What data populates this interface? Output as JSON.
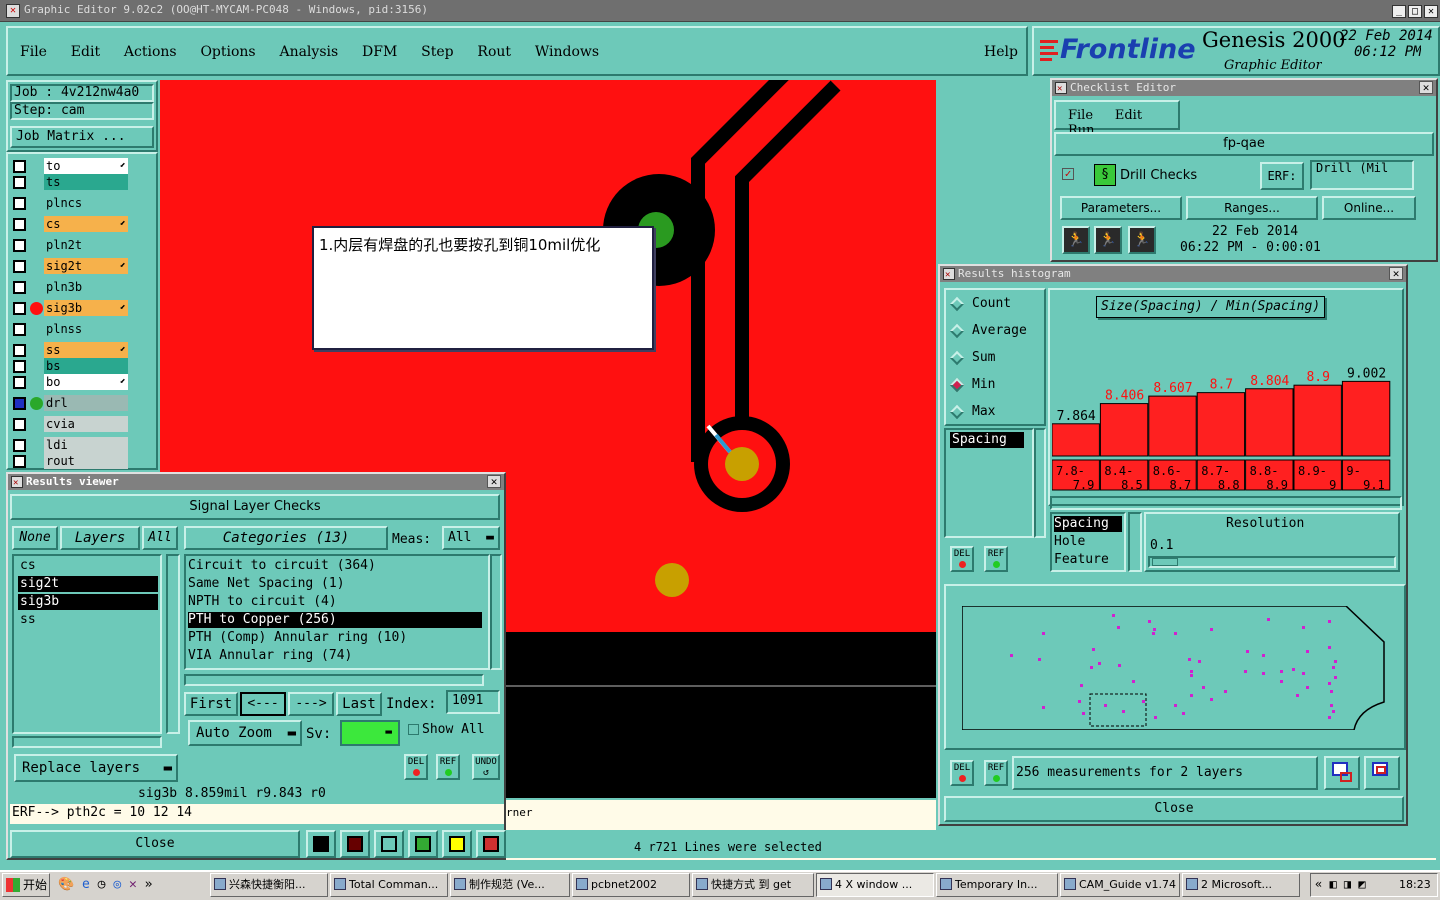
{
  "window": {
    "title": "Graphic Editor 9.02c2  (OO@HT-MYCAM-PC048 - Windows, pid:3156)"
  },
  "menu": [
    "File",
    "Edit",
    "Actions",
    "Options",
    "Analysis",
    "DFM",
    "Step",
    "Rout",
    "Windows"
  ],
  "help": "Help",
  "brand": {
    "logo": "Frontline",
    "product": "Genesis 2000",
    "subtitle": "Graphic Editor",
    "date": "22 Feb 2014",
    "time": "06:12 PM"
  },
  "job": {
    "job": "Job : 4v212nw4a0",
    "step": "Step: cam",
    "matrix": "Job Matrix ..."
  },
  "layers": [
    {
      "name": "to",
      "color": "#ffffff"
    },
    {
      "name": "ts",
      "color": "#2aa88f"
    },
    {
      "name": "plncs",
      "color": "#6dc9b9"
    },
    {
      "name": "cs",
      "color": "#f6b14b"
    },
    {
      "name": "pln2t",
      "color": "#6dc9b9"
    },
    {
      "name": "sig2t",
      "color": "#f6b14b"
    },
    {
      "name": "pln3b",
      "color": "#6dc9b9"
    },
    {
      "name": "sig3b",
      "color": "#f6b14b"
    },
    {
      "name": "plnss",
      "color": "#6dc9b9"
    },
    {
      "name": "ss",
      "color": "#f6b14b"
    },
    {
      "name": "bs",
      "color": "#2aa88f"
    },
    {
      "name": "bo",
      "color": "#ffffff"
    },
    {
      "name": "drl",
      "color": "#9ab9b3"
    },
    {
      "name": "cvia",
      "color": "#c8d3d0"
    },
    {
      "name": "ldi",
      "color": "#c8d3d0"
    },
    {
      "name": "rout",
      "color": "#c8d3d0"
    }
  ],
  "note": "1.内层有焊盘的孔也要按孔到铜10mil优化",
  "results_viewer": {
    "title": "Results viewer",
    "header": "Signal Layer Checks",
    "none": "None",
    "layers": "Layers",
    "all": "All",
    "categories": "Categories (13)",
    "meas_label": "Meas:",
    "meas_value": "All",
    "layer_list": [
      "cs",
      "sig2t",
      "sig3b",
      "ss"
    ],
    "category_list": [
      "Circuit to circuit (364)",
      "Same Net Spacing (1)",
      "NPTH to circuit (4)",
      "PTH to Copper (256)",
      "PTH (Comp) Annular ring (10)",
      "VIA Annular ring (74)"
    ],
    "first": "First",
    "prev": "<---",
    "next": "--->",
    "last": "Last",
    "index_label": "Index:",
    "index_value": "1091",
    "auto_zoom": "Auto Zoom",
    "sv": "Sv:",
    "show_all": "Show All",
    "replace": "Replace layers",
    "del": "DEL",
    "ref": "REF",
    "undo": "UNDO",
    "status": "sig3b 8.859mil  r9.843  r0",
    "erf": "ERF--> pth2c = 10 12 14",
    "close": "Close"
  },
  "checklist": {
    "title": "Checklist Editor",
    "menu": [
      "File",
      "Edit",
      "Run"
    ],
    "name": "fp-qae",
    "check": "Drill Checks",
    "erf": "ERF:",
    "erf_value": "Drill (Mil",
    "parameters": "Parameters...",
    "ranges": "Ranges...",
    "online": "Online...",
    "date": "22 Feb 2014",
    "time": "06:22 PM - 0:00:01"
  },
  "histogram": {
    "title": "Results histogram",
    "options": [
      "Count",
      "Average",
      "Sum",
      "Min",
      "Max"
    ],
    "selected": "Min",
    "heading": "Size(Spacing) / Min(Spacing)",
    "list1": [
      "Spacing"
    ],
    "list2": [
      "Spacing",
      "Hole",
      "Feature"
    ],
    "resolution_label": "Resolution",
    "resolution_value": "0.1",
    "measurements": "256 measurements for 2 layers",
    "close": "Close",
    "del": "DEL",
    "ref": "REF"
  },
  "chart_data": {
    "type": "bar",
    "categories": [
      "7.8-7.9",
      "8.4-8.5",
      "8.6-8.7",
      "8.7-8.8",
      "8.8-8.9",
      "8.9-9",
      "9-9.1"
    ],
    "values": [
      7.864,
      8.406,
      8.607,
      8.7,
      8.804,
      8.9,
      9.002
    ],
    "value_labels": [
      "7.864",
      "8.406",
      "8.607",
      "8.7",
      "8.804",
      "8.9",
      "9.002"
    ],
    "title": "Size(Spacing) / Min(Spacing)"
  },
  "status_bar": {
    "text": "4 r721 Lines were selected",
    "corner": "rner"
  },
  "taskbar": {
    "start": "开始",
    "items": [
      "兴森快捷衡阳...",
      "Total Comman...",
      "制作规范 (Ve...",
      "pcbnet2002",
      "快捷方式 到 get",
      "4 X window ...",
      "Temporary In...",
      "CAM_Guide v1.74",
      "2 Microsoft..."
    ],
    "clock": "18:23"
  }
}
